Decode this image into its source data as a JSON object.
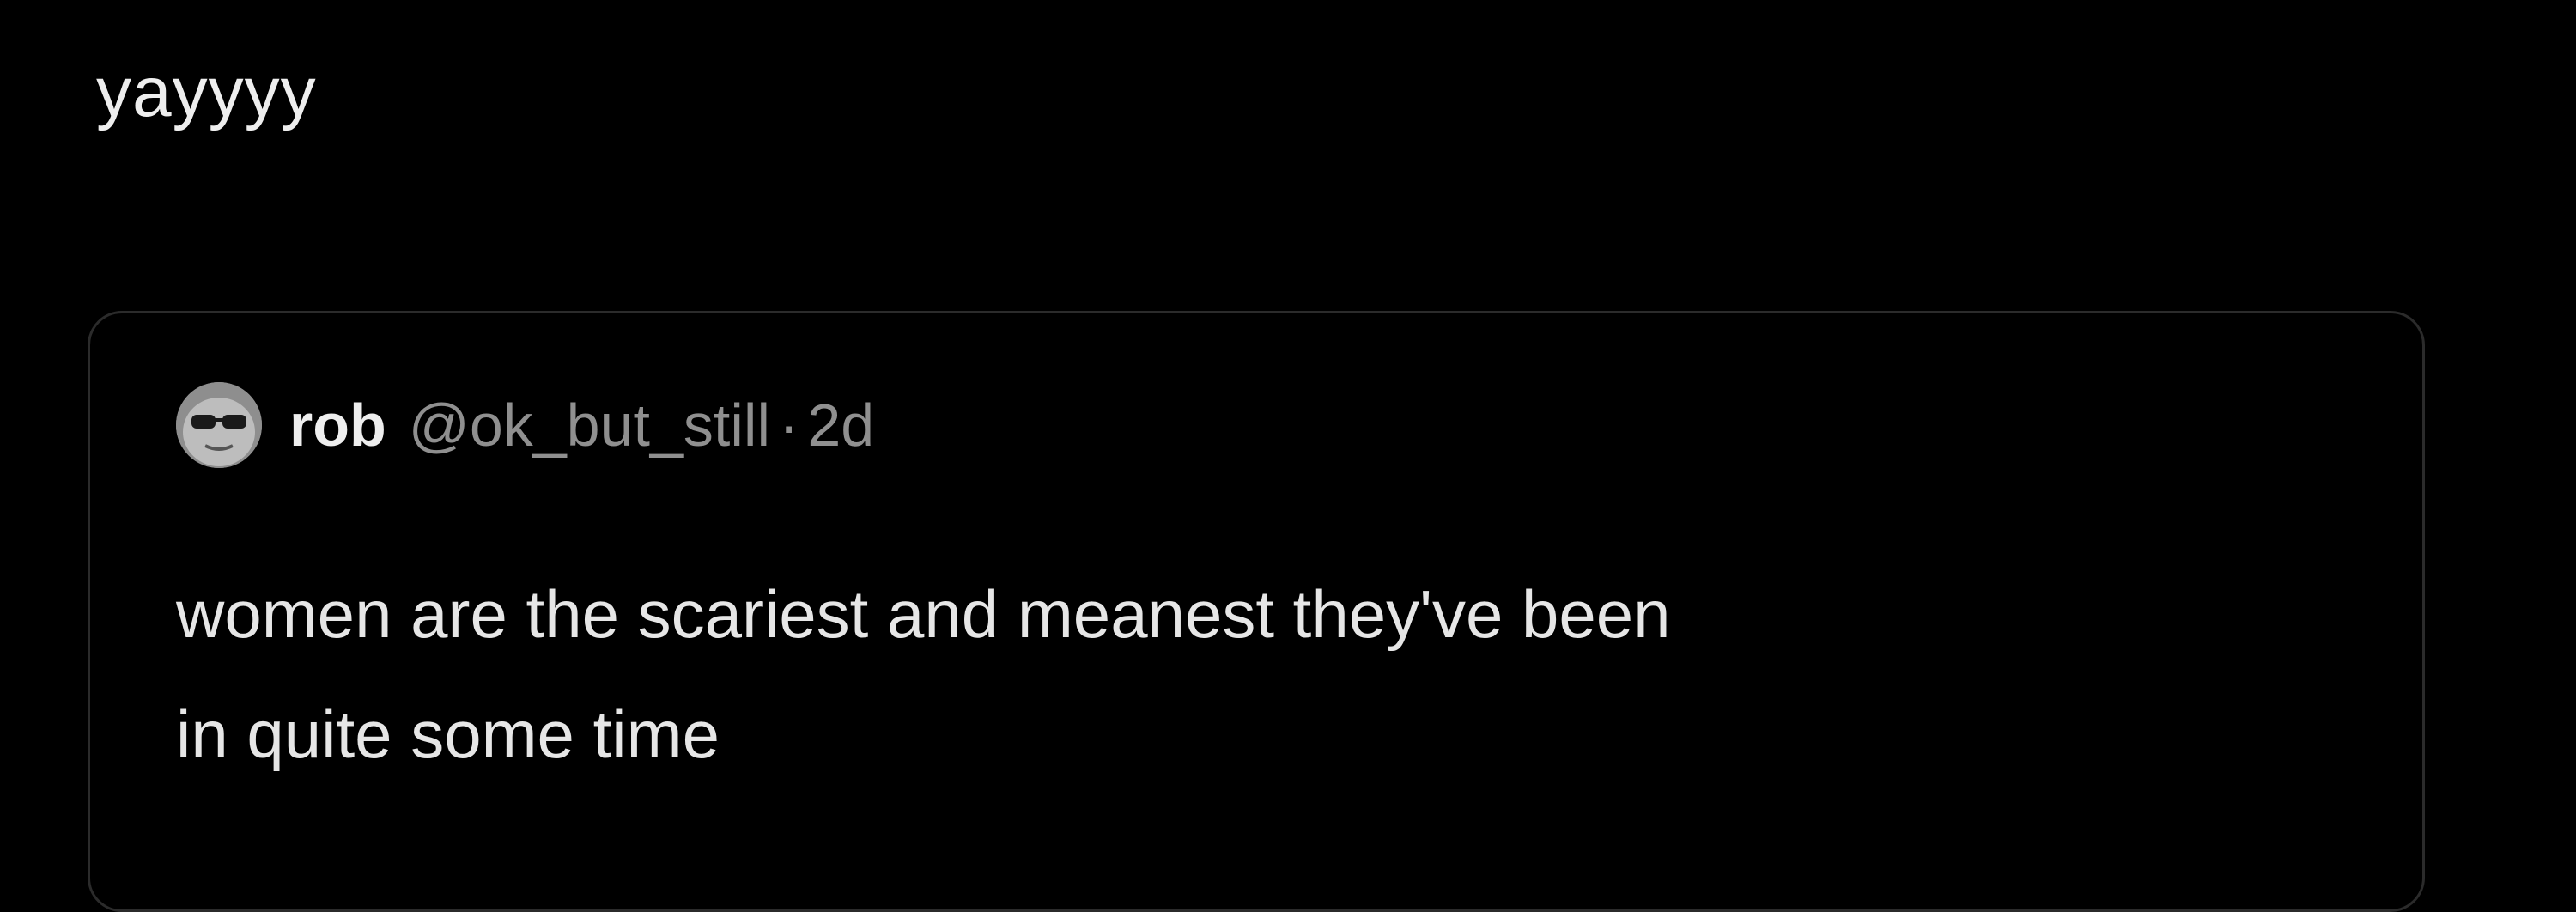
{
  "post": {
    "text": "yayyyy"
  },
  "quoted_post": {
    "avatar_icon": "avatar-sunglasses-face",
    "author_name": "rob",
    "author_handle": "@ok_but_still",
    "separator": "·",
    "timestamp": "2d",
    "body_line_1": "women are the scariest and meanest they've been",
    "body_line_2": "in quite some time"
  },
  "colors": {
    "background": "#000000",
    "primary_text": "#eeeeee",
    "secondary_text": "#8f8f8f",
    "card_border": "#2b2b2b"
  }
}
